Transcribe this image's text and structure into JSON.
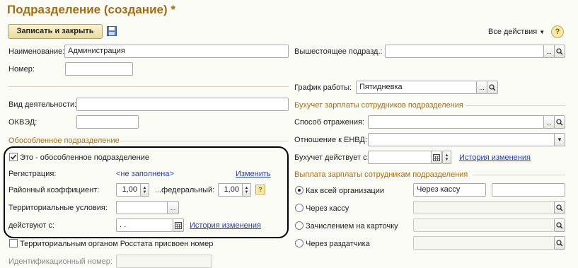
{
  "window": {
    "title": "Подразделение (создание) *"
  },
  "toolbar": {
    "save_close_label": "Записать и закрыть",
    "all_actions_label": "Все действия",
    "help_glyph": "?"
  },
  "left": {
    "name_label": "Наименование:",
    "name_value": "Администрация",
    "number_label": "Номер:",
    "number_value": "",
    "activity_label": "Вид деятельности:",
    "activity_value": "",
    "okved_label": "ОКВЭД:",
    "okved_value": "",
    "separate_section": "Обособленное подразделение",
    "is_separate_label": "Это - обособленное подразделение",
    "is_separate_checked": true,
    "registration_label": "Регистрация:",
    "registration_value": "<не заполнена>",
    "change_link": "Изменить",
    "district_coef_label": "Районный коэффициент:",
    "district_coef_value": "1,00",
    "federal_label": "...федеральный:",
    "federal_value": "1,00",
    "federal_help": "?",
    "territorial_label": "Территориальные условия:",
    "territorial_value": "",
    "effective_label": "действуют с:",
    "effective_value": " .  .",
    "history_link": "История изменения",
    "rosstat_label": "Территориальным органом Росстата присвоен номер",
    "id_number_label": "Идентификационный номер:",
    "id_number_value": ""
  },
  "right": {
    "parent_label": "Вышестоящее подразд.:",
    "parent_value": "",
    "schedule_label": "График работы:",
    "schedule_value": "Пятидневка",
    "accounting_section": "Бухучет зарплаты сотрудников подразделения",
    "reflection_label": "Способ отражения:",
    "reflection_value": "",
    "envd_label": "Отношение к ЕНВД:",
    "envd_value": "",
    "accounting_from_label": "Бухучет действует с:",
    "accounting_from_value": "",
    "history_link": "История изменения",
    "payout_section": "Выплата зарплаты сотрудникам подразделения",
    "opt_org_label": "Как всей организации",
    "opt_org_value": "Через кассу",
    "opt_org_extra": "",
    "opt_cash_label": "Через кассу",
    "opt_cash_value": "",
    "opt_card_label": "Зачислением на карточку",
    "opt_card_value": "",
    "opt_dist_label": "Через раздатчика",
    "opt_dist_value": "",
    "selected_option": "opt_org"
  },
  "icons": {
    "dots": "...",
    "search": "search-icon",
    "calendar": "calendar-icon",
    "save": "floppy-icon"
  },
  "colors": {
    "title": "#a06e16",
    "section": "#a06e16",
    "link": "#2a3fa8",
    "button_bg": "#f3e9b8"
  }
}
